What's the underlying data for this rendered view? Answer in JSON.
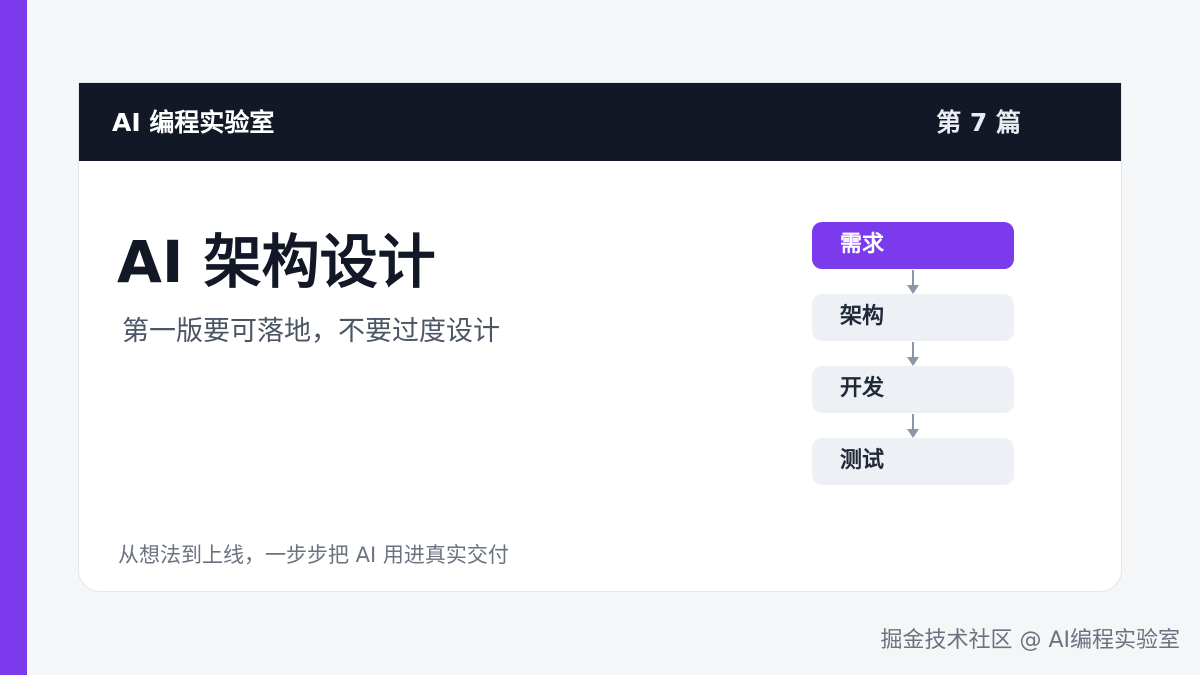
{
  "brand": "AI 编程实验室",
  "issue": "第 7 篇",
  "title": "AI 架构设计",
  "subtitle": "第一版要可落地，不要过度设计",
  "footer": "从想法到上线，一步步把 AI 用进真实交付",
  "workflow": [
    {
      "label": "需求",
      "active": true
    },
    {
      "label": "架构",
      "active": false
    },
    {
      "label": "开发",
      "active": false
    },
    {
      "label": "测试",
      "active": false
    }
  ],
  "watermark": "掘金技术社区 @ AI编程实验室",
  "colors": {
    "accent": "#7c3aed",
    "header": "#121826",
    "inactive_step": "#edf1f6"
  }
}
